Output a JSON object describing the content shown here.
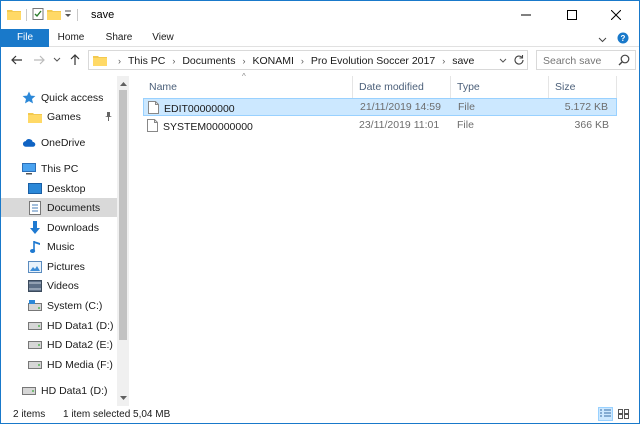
{
  "window": {
    "title": "save"
  },
  "ribbon": {
    "tabs": [
      "File",
      "Home",
      "Share",
      "View"
    ]
  },
  "address": {
    "crumbs": [
      "This PC",
      "Documents",
      "KONAMI",
      "Pro Evolution Soccer 2017",
      "save"
    ],
    "search_placeholder": "Search save"
  },
  "nav": {
    "items": [
      {
        "label": "Quick access",
        "icon": "star-icon"
      },
      {
        "label": "Games",
        "icon": "folder-icon"
      },
      {
        "label": "OneDrive",
        "icon": "cloud-icon"
      },
      {
        "label": "This PC",
        "icon": "computer-icon"
      },
      {
        "label": "Desktop",
        "icon": "desktop-icon"
      },
      {
        "label": "Documents",
        "icon": "documents-icon"
      },
      {
        "label": "Downloads",
        "icon": "download-icon"
      },
      {
        "label": "Music",
        "icon": "music-icon"
      },
      {
        "label": "Pictures",
        "icon": "pictures-icon"
      },
      {
        "label": "Videos",
        "icon": "videos-icon"
      },
      {
        "label": "System (C:)",
        "icon": "drive-icon"
      },
      {
        "label": "HD Data1 (D:)",
        "icon": "drive-icon"
      },
      {
        "label": "HD Data2 (E:)",
        "icon": "drive-icon"
      },
      {
        "label": "HD Media (F:)",
        "icon": "drive-icon"
      },
      {
        "label": "HD Data1 (D:)",
        "icon": "drive-icon"
      }
    ]
  },
  "files": {
    "columns": [
      "Name",
      "Date modified",
      "Type",
      "Size"
    ],
    "rows": [
      {
        "name": "EDIT00000000",
        "date": "21/11/2019 14:59",
        "type": "File",
        "size": "5.172 KB"
      },
      {
        "name": "SYSTEM00000000",
        "date": "23/11/2019 11:01",
        "type": "File",
        "size": "366 KB"
      }
    ]
  },
  "status": {
    "count": "2 items",
    "selection": "1 item selected  5,04 MB"
  },
  "colors": {
    "accent": "#1979ca",
    "selection": "#cce8ff",
    "selection_border": "#99d1ff"
  }
}
